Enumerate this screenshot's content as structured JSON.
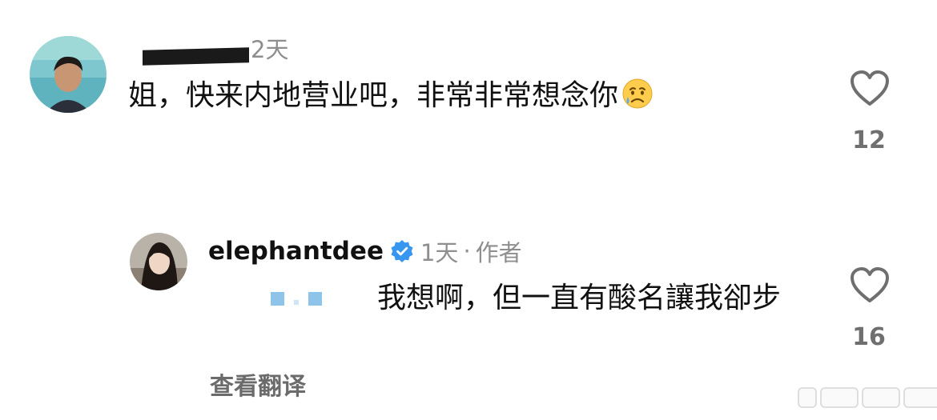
{
  "comments": [
    {
      "username": "",
      "time": "2天",
      "text": "姐，快来内地营业吧，非常非常想念你",
      "emoji": "crying-face-emoji",
      "likes": "12"
    },
    {
      "username": "elephantdee",
      "verified": true,
      "time": "1天",
      "separator": "·",
      "author_label": "作者",
      "text": "我想啊，但一直有酸名讓我卻步",
      "likes": "16",
      "translate_label": "查看翻译"
    }
  ],
  "colors": {
    "text": "#111111",
    "muted": "#8e8e8e",
    "verified": "#3797f0",
    "mention": "#8fc4ea"
  }
}
